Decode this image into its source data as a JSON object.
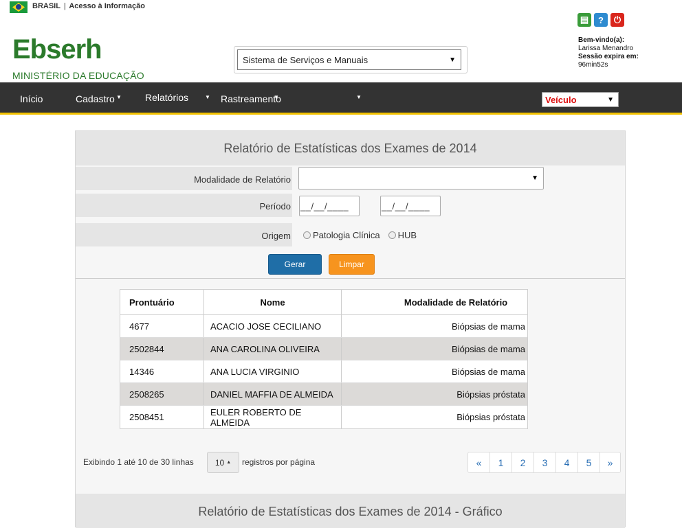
{
  "gov_bar": {
    "country": "BRASIL",
    "separator": "|",
    "link": "Acesso à Informação"
  },
  "header": {
    "logo": "Ebserh",
    "ministry": "MINISTÉRIO DA EDUCAÇÃO",
    "system_select": "Sistema de Serviços e Manuais",
    "icons": [
      "printer-icon",
      "help-icon",
      "power-icon"
    ],
    "icon_glyphs": {
      "help": "?",
      "power": "⏻",
      "print": "▤"
    }
  },
  "user": {
    "welcome_label": "Bem-vindo(a):",
    "name": "Larissa Menandro",
    "session_label": "Sessão expira em:",
    "session_time": "96min52s"
  },
  "nav": {
    "items": [
      "Início",
      "Cadastro",
      "Relatórios",
      "Rastreamento"
    ],
    "vehicle_select": "Veículo",
    "accent_color": "#f2c200"
  },
  "report": {
    "title": "Relatório de Estatísticas dos Exames de 2014",
    "modalidade_label": "Modalidade de Relatório",
    "modalidade_value": "",
    "periodo_label": "Período",
    "date_placeholder_1": "__/__/____",
    "date_placeholder_2": "__/__/____",
    "origem_label": "Origem",
    "origem_options": [
      "Patologia Clínica",
      "HUB"
    ],
    "gerar_label": "Gerar",
    "limpar_label": "Limpar"
  },
  "table": {
    "columns": [
      "Prontuário",
      "Nome",
      "Modalidade de Relatório"
    ],
    "rows": [
      [
        "4677",
        "ACACIO JOSE CECILIANO",
        "Biópsias de mama"
      ],
      [
        "2502844",
        "ANA CAROLINA OLIVEIRA",
        "Biópsias de mama"
      ],
      [
        "14346",
        "ANA LUCIA VIRGINIO",
        "Biópsias de mama"
      ],
      [
        "2508265",
        "DANIEL MAFFIA DE ALMEIDA",
        "Biópsias próstata"
      ],
      [
        "2508451",
        "EULER ROBERTO DE ALMEIDA",
        "Biópsias próstata"
      ]
    ]
  },
  "pagination": {
    "showing": "Exibindo 1 até 10 de 30 linhas",
    "page_size": "10",
    "per_page_label": "registros por página",
    "pages": [
      "«",
      "1",
      "2",
      "3",
      "4",
      "5",
      "»"
    ]
  },
  "chart_section_title": "Relatório de Estatísticas dos Exames de 2014 - Gráfico"
}
